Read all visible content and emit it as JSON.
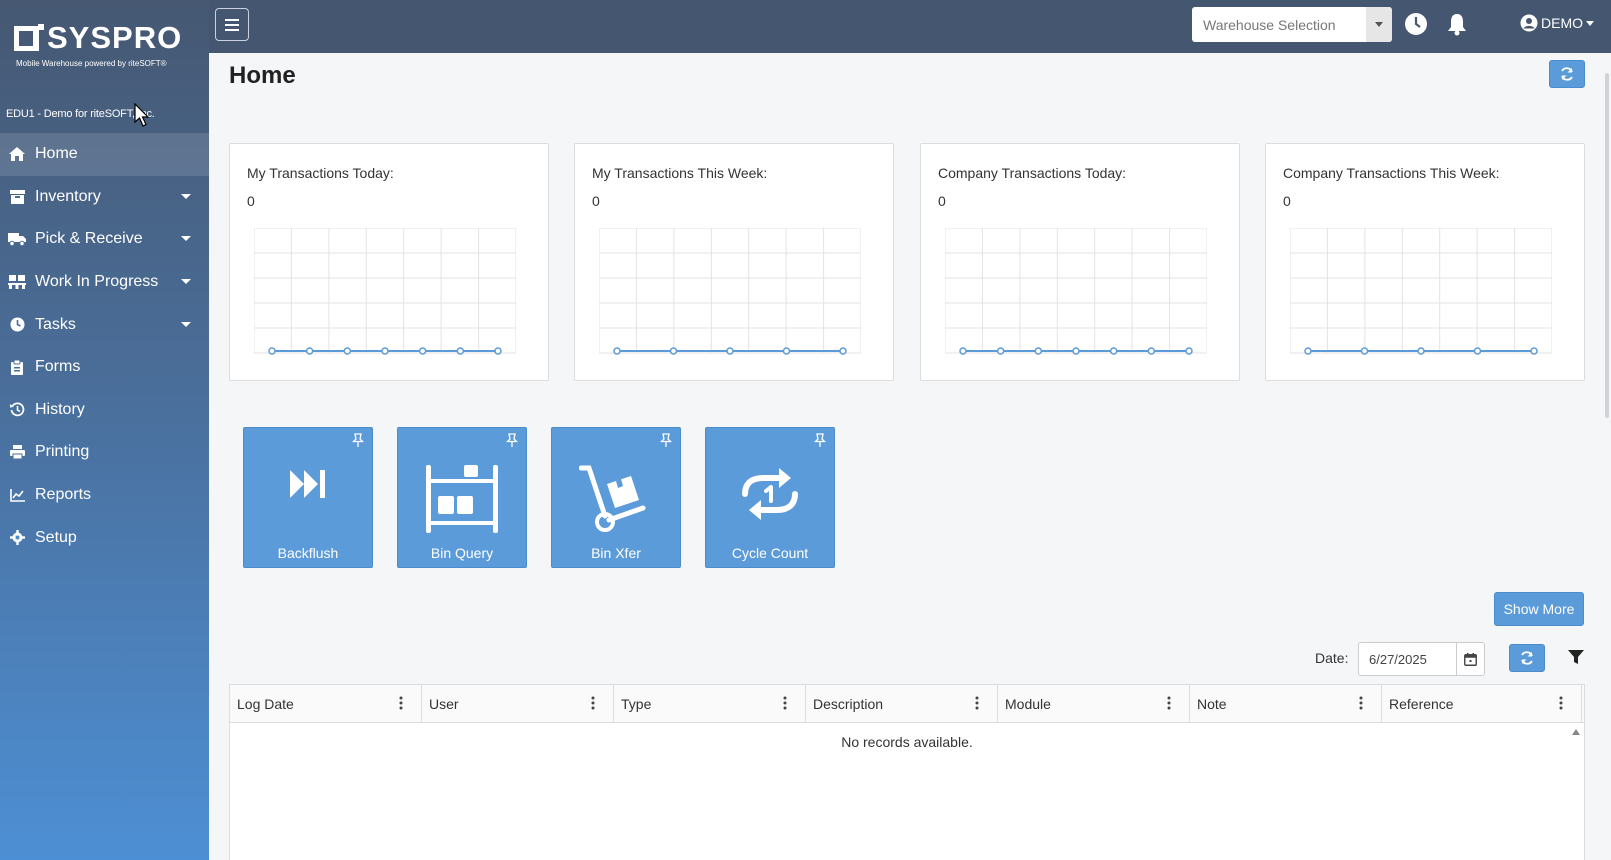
{
  "brand": {
    "name": "SYSPRO",
    "tagline": "Mobile Warehouse powered by riteSOFT®"
  },
  "company": "EDU1 - Demo for riteSOFT, Inc.",
  "sidebar": {
    "items": [
      {
        "label": "Home",
        "icon": "home-icon",
        "active": true
      },
      {
        "label": "Inventory",
        "icon": "box-icon",
        "caret": true
      },
      {
        "label": "Pick & Receive",
        "icon": "truck-icon",
        "caret": true
      },
      {
        "label": "Work In Progress",
        "icon": "pallet-icon",
        "caret": true
      },
      {
        "label": "Tasks",
        "icon": "clock-icon",
        "caret": true
      },
      {
        "label": "Forms",
        "icon": "clipboard-icon"
      },
      {
        "label": "History",
        "icon": "history-icon"
      },
      {
        "label": "Printing",
        "icon": "printer-icon"
      },
      {
        "label": "Reports",
        "icon": "chart-icon"
      },
      {
        "label": "Setup",
        "icon": "gear-icon"
      }
    ]
  },
  "topbar": {
    "warehouse_placeholder": "Warehouse Selection",
    "user": "DEMO"
  },
  "page": {
    "title": "Home"
  },
  "cards": [
    {
      "label": "My Transactions Today:",
      "value": "0"
    },
    {
      "label": "My Transactions This Week:",
      "value": "0"
    },
    {
      "label": "Company Transactions Today:",
      "value": "0"
    },
    {
      "label": "Company Transactions This Week:",
      "value": "0"
    }
  ],
  "tiles": [
    {
      "label": "Backflush",
      "icon": "fast-forward-icon"
    },
    {
      "label": "Bin Query",
      "icon": "bin-rack-icon"
    },
    {
      "label": "Bin Xfer",
      "icon": "hand-truck-icon"
    },
    {
      "label": "Cycle Count",
      "icon": "cycle-count-icon"
    }
  ],
  "actions": {
    "show_more": "Show More"
  },
  "filter": {
    "date_label": "Date:",
    "date_value": "6/27/2025"
  },
  "grid": {
    "columns": [
      "Log Date",
      "User",
      "Type",
      "Description",
      "Module",
      "Note",
      "Reference"
    ],
    "empty_message": "No records available."
  },
  "colors": {
    "sidebar_top": "#465872",
    "sidebar_bottom": "#4d8fd4",
    "topbar": "#455671",
    "accent": "#5b9bd9"
  }
}
